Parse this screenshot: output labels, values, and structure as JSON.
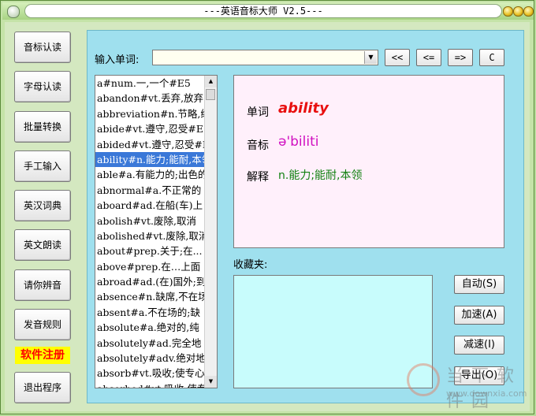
{
  "window": {
    "title": "---英语音标大师 V2.5---"
  },
  "sidebar": {
    "buttons": [
      "音标认读",
      "字母认读",
      "批量转换",
      "手工输入",
      "英汉词典",
      "英文朗读",
      "请你辨音",
      "发音规则"
    ],
    "register_label": "软件注册",
    "exit_label": "退出程序"
  },
  "input": {
    "label": "输入单词:",
    "value": ""
  },
  "nav": [
    "<<",
    "<=",
    "=>",
    "C"
  ],
  "word_list": {
    "items": [
      "a#num.一,一个#E5",
      "abandon#vt.丢弃,放弃",
      "abbreviation#n.节略,缩写",
      "abide#vt.遵守,忍受#E5",
      "abided#vt.遵守,忍受#E5",
      "ability#n.能力;能耐,本领",
      "able#a.有能力的;出色的",
      "abnormal#a.不正常的",
      "aboard#ad.在船(车)上",
      "abolish#vt.废除,取消",
      "abolished#vt.废除,取消",
      "about#prep.关于;在...",
      "above#prep.在…上面",
      "abroad#ad.(在)国外;到",
      "absence#n.缺席,不在场",
      "absent#a.不在场的;缺",
      "absolute#a.绝对的,纯",
      "absolutely#ad.完全地",
      "absolutely#adv.绝对地",
      "absorb#vt.吸收;使专心",
      "absorbed#vt.吸收,使专"
    ],
    "selected_index": 5
  },
  "detail": {
    "word_label": "单词",
    "word": "ability",
    "phonetic_label": "音标",
    "phonetic": "ə'biliti",
    "meaning_label": "解释",
    "meaning": "n.能力;能耐,本领"
  },
  "favorites": {
    "label": "收藏夹:"
  },
  "controls": {
    "auto": "自动(S)",
    "faster": "加速(A)",
    "slower": "减速(I)",
    "export": "导出(O)"
  },
  "watermark": {
    "name": "当下软件园",
    "url": "www.downxia.com"
  }
}
